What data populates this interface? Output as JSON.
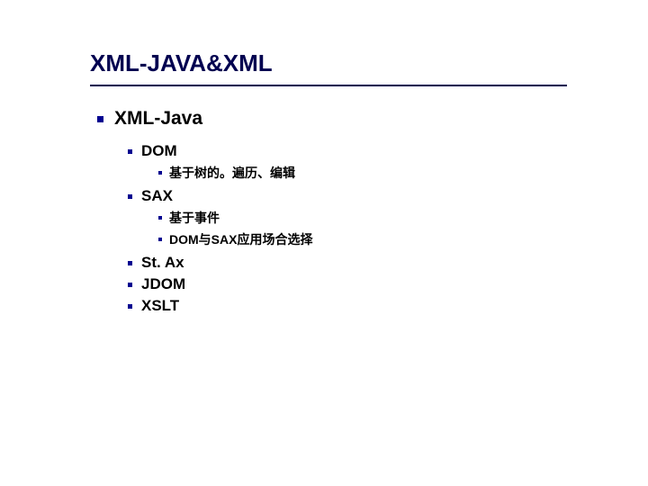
{
  "title": "XML-JAVA&XML",
  "section": {
    "heading": "XML-Java",
    "items": [
      {
        "label": "DOM",
        "children": [
          {
            "label": "基于树的。遍历、编辑"
          }
        ]
      },
      {
        "label": "SAX",
        "children": [
          {
            "label": "基于事件"
          },
          {
            "label": "DOM与SAX应用场合选择"
          }
        ]
      },
      {
        "label": "St. Ax"
      },
      {
        "label": "JDOM"
      },
      {
        "label": "XSLT"
      }
    ]
  }
}
